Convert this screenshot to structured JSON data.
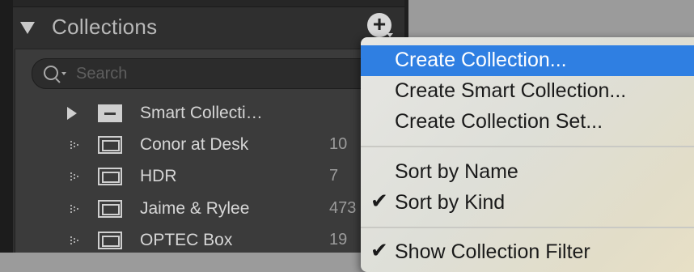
{
  "panel": {
    "section_title": "Collections",
    "add_button_symbol": "+",
    "search": {
      "placeholder": "Search",
      "value": ""
    },
    "rows": [
      {
        "label": "Smart Collecti…",
        "count": "",
        "type": "smart-collection-set",
        "icon": "smart-collection-set-icon"
      },
      {
        "label": "Conor at Desk",
        "count": "10",
        "type": "collection",
        "icon": "collection-icon"
      },
      {
        "label": "HDR",
        "count": "7",
        "type": "collection",
        "icon": "collection-icon"
      },
      {
        "label": "Jaime & Rylee",
        "count": "473",
        "type": "collection",
        "icon": "collection-icon"
      },
      {
        "label": "OPTEC Box",
        "count": "19",
        "type": "collection",
        "icon": "collection-icon"
      }
    ]
  },
  "menu": {
    "items": [
      {
        "label": "Create Collection...",
        "highlighted": true,
        "checked": false
      },
      {
        "label": "Create Smart Collection...",
        "highlighted": false,
        "checked": false
      },
      {
        "label": "Create Collection Set...",
        "highlighted": false,
        "checked": false
      },
      {
        "label": "Sort by Name",
        "highlighted": false,
        "checked": false
      },
      {
        "label": "Sort by Kind",
        "highlighted": false,
        "checked": true
      },
      {
        "label": "Show Collection Filter",
        "highlighted": false,
        "checked": true
      }
    ],
    "check_symbol": "✔"
  },
  "colors": {
    "panel_bg": "#2f2f2f",
    "list_bg": "#3b3b3b",
    "menu_highlight": "#2f7fe2",
    "menu_text": "#1a1a1a"
  }
}
